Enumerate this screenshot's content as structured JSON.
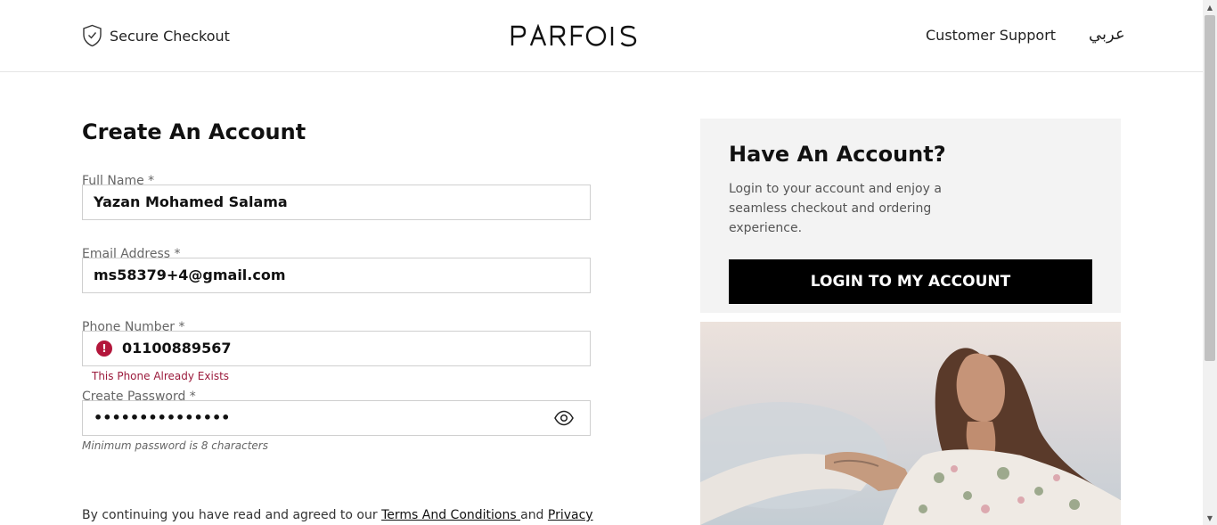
{
  "header": {
    "secure_label": "Secure Checkout",
    "brand": "PARFOIS",
    "support_label": "Customer Support",
    "language_label": "عربي"
  },
  "form": {
    "title": "Create An Account",
    "full_name": {
      "label": "Full Name *",
      "value": "Yazan Mohamed Salama"
    },
    "email": {
      "label": "Email Address *",
      "value": "ms58379+4@gmail.com"
    },
    "phone": {
      "label": "Phone Number *",
      "value": "01100889567",
      "error": "This Phone Already Exists"
    },
    "password": {
      "label": "Create Password *",
      "value": "•••••••••••••••",
      "hint": "Minimum password is 8 characters"
    },
    "terms": {
      "prefix": "By continuing you have read and agreed to our ",
      "link1": "Terms And Conditions ",
      "middle": "and ",
      "link2": "Privacy"
    }
  },
  "account": {
    "title": "Have An Account?",
    "description": "Login to your account and enjoy a seamless checkout and ordering experience.",
    "login_label": "LOGIN TO MY ACCOUNT"
  },
  "colors": {
    "error": "#b3163b",
    "button_bg": "#000000",
    "panel_bg": "#f3f3f3"
  }
}
